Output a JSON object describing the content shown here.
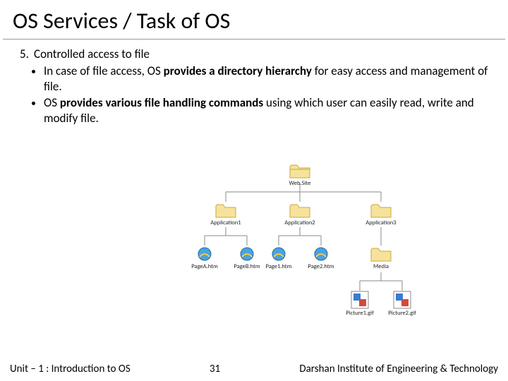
{
  "title": "OS Services / Task of OS",
  "item_number": "5.",
  "item_heading": "Controlled access to file",
  "bullets": {
    "b1_pre": "In case of file access, OS ",
    "b1_bold": "provides a directory hierarchy",
    "b1_post": " for easy access and management of file.",
    "b2_pre": "OS ",
    "b2_bold": "provides various file handling commands",
    "b2_post": " using which user can easily read, write and modify file."
  },
  "diagram": {
    "root": "Web.Site",
    "app1": "Application1",
    "app2": "Application2",
    "app3": "Application3",
    "pageA": "PageA.htm",
    "pageB": "PageB.htm",
    "page1": "Page1.htm",
    "page2": "Page2.htm",
    "media": "Media",
    "pic1": "Picture1.gif",
    "pic2": "Picture2.gif"
  },
  "footer": {
    "unit": "Unit – 1 : Introduction to OS",
    "page": "31",
    "org": "Darshan Institute of Engineering & Technology"
  }
}
